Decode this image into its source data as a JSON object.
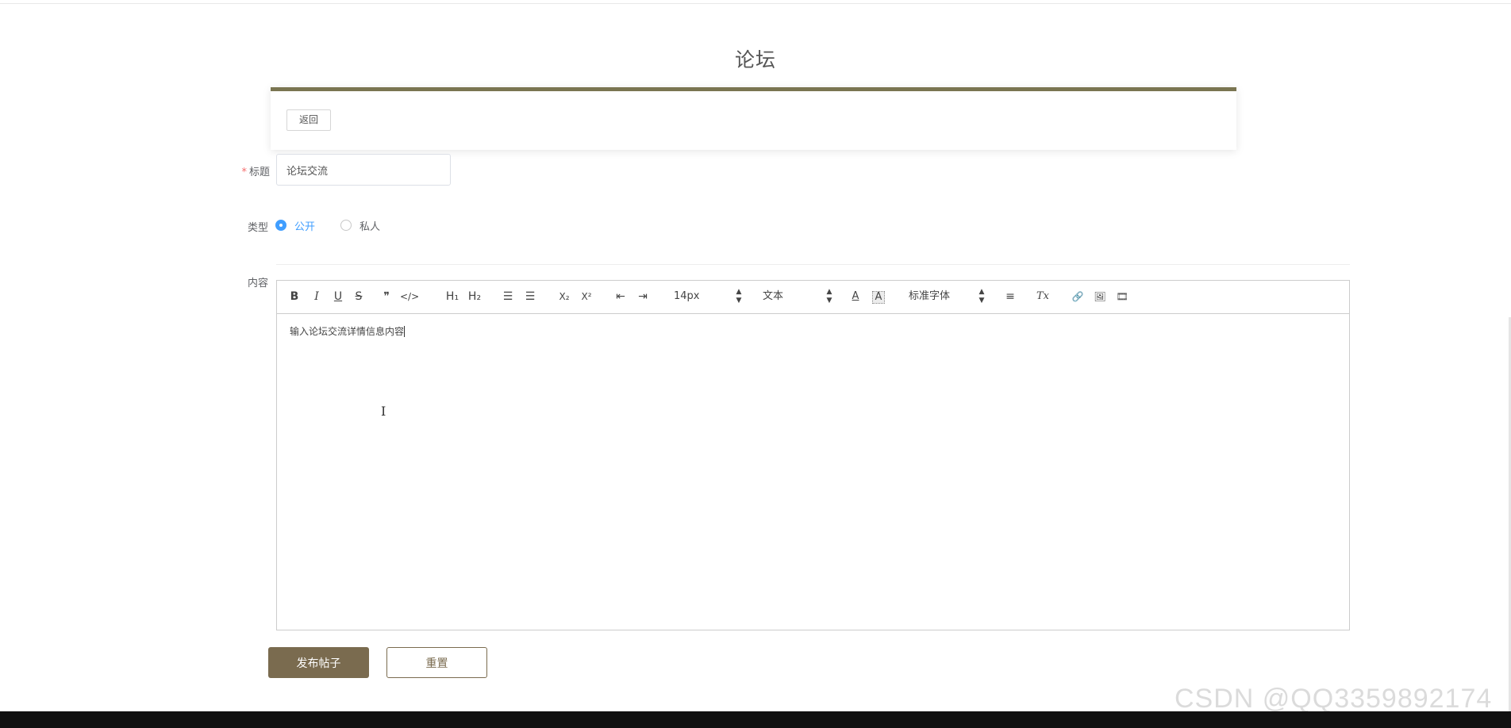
{
  "page": {
    "title": "论坛"
  },
  "header": {
    "back_label": "返回"
  },
  "form": {
    "title_label": "标题",
    "title_value": "论坛交流",
    "type_label": "类型",
    "type_options": [
      {
        "label": "公开",
        "checked": true
      },
      {
        "label": "私人",
        "checked": false
      }
    ],
    "content_label": "内容"
  },
  "editor": {
    "toolbar": {
      "bold": "B",
      "italic": "I",
      "underline": "U",
      "strike": "S",
      "quote": "❞",
      "code": "</>",
      "h1": "H₁",
      "h2": "H₂",
      "ordered_list": "☰",
      "bullet_list": "☰",
      "subscript": "X₂",
      "superscript": "X²",
      "outdent": "⇤",
      "indent": "⇥",
      "size_value": "14px",
      "header_value": "文本",
      "color": "A",
      "background": "A",
      "font_value": "标准字体",
      "align": "≡",
      "clean": "Tx",
      "link": "🔗",
      "image": "🖼",
      "video": "🎞"
    },
    "content_text": "输入论坛交流详情信息内容"
  },
  "actions": {
    "submit_label": "发布帖子",
    "reset_label": "重置"
  },
  "watermark": "CSDN @QQ3359892174",
  "colors": {
    "accent": "#7a6b4f",
    "header_border": "#7a7551",
    "primary": "#409eff"
  }
}
